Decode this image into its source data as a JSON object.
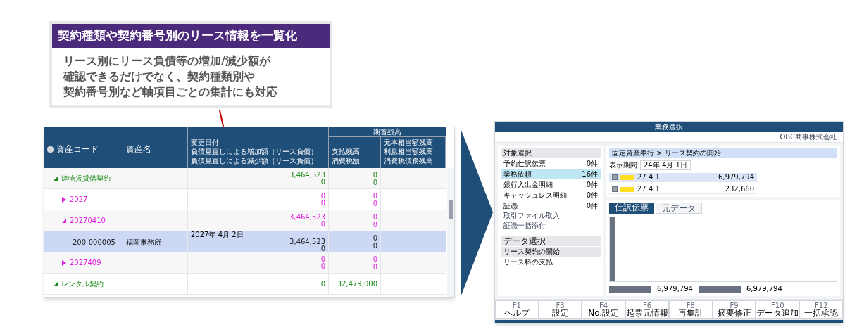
{
  "callout": {
    "title": "契約種類や契約番号別のリース情報を一覧化",
    "body": [
      "リース別にリース負債等の増加/減少額が",
      "確認できるだけでなく、契約種類別や",
      "契約番号別など軸項目ごとの集計にも対応"
    ]
  },
  "left_table": {
    "group_header": "期首残高",
    "columns": [
      [
        "資産コード"
      ],
      [
        "資産名"
      ],
      [
        "変更日付",
        "負債見直しによる増加額（リース負債）",
        "負債見直しによる減少額（リース負債）"
      ],
      [
        "支払残高",
        "消費税額"
      ],
      [
        "元本相当額残高",
        "利息相当額残高",
        "消費税債務残高"
      ]
    ],
    "rows": [
      {
        "kind": "group",
        "code": "建物賃貸借契約",
        "expanded": true,
        "selected": false,
        "color": "#1a8a1a",
        "amounts": [
          "3,464,523",
          "0"
        ],
        "balances": [
          "0",
          "0"
        ]
      },
      {
        "kind": "group",
        "code": "2027",
        "expanded": false,
        "selected": false,
        "color": "#e020e0",
        "amounts": [
          "0",
          "0"
        ],
        "balances": [
          "0",
          "0"
        ]
      },
      {
        "kind": "group",
        "code": "20270410",
        "expanded": true,
        "selected": false,
        "color": "#e020e0",
        "amounts": [
          "3,464,523",
          "0"
        ],
        "balances": [
          "0",
          "0"
        ]
      },
      {
        "kind": "item",
        "code": "200-000005",
        "name": "福岡事務所",
        "date": "2027年  4月  2日",
        "selected": true,
        "amounts": [
          "3,464,523",
          "0"
        ],
        "balances": [
          "0",
          "0"
        ]
      },
      {
        "kind": "group",
        "code": "2027409",
        "expanded": false,
        "selected": false,
        "color": "#e020e0",
        "amounts": [
          "0",
          "0"
        ],
        "balances": [
          "0",
          "0"
        ]
      },
      {
        "kind": "group",
        "code": "レンタル契約",
        "expanded": true,
        "selected": false,
        "color": "#1a8a1a",
        "amounts": [
          "0"
        ],
        "balances": [
          "32,479,000"
        ]
      }
    ]
  },
  "app": {
    "title": "業務選択",
    "company": "OBC商事株式会社",
    "sidebar_heading": "対象選択",
    "targets": [
      {
        "label": "予約仕訳伝票",
        "count": "0",
        "unit": "件",
        "selected": false
      },
      {
        "label": "業務依頼",
        "count": "16",
        "unit": "件",
        "selected": true
      },
      {
        "label": "銀行入出金明細",
        "count": "0",
        "unit": "件",
        "selected": false
      },
      {
        "label": "キャッシュレス明細",
        "count": "0",
        "unit": "件",
        "selected": false
      },
      {
        "label": "証憑",
        "count": "0",
        "unit": "件",
        "selected": false
      }
    ],
    "links": [
      "取引ファイル取入",
      "証憑一括添付"
    ],
    "data_heading": "データ選択",
    "data_items": [
      {
        "label": "リース契約の開始",
        "selected": true
      },
      {
        "label": "リース料の支払",
        "selected": false
      }
    ],
    "breadcrumb": "固定資産奉行 > リース契約の開始",
    "period_label": "表示期間",
    "period_from": "24年 4月 1日",
    "list_rows": [
      {
        "checked": true,
        "date": "27  4  1",
        "amount": "6,979,794",
        "selected": true
      },
      {
        "checked": true,
        "date": "27  4  1",
        "amount": "232,660",
        "selected": false
      }
    ],
    "tabs": [
      {
        "label": "仕訳伝票",
        "selected": true
      },
      {
        "label": "元データ",
        "selected": false
      }
    ],
    "debit_total": "6,979,794",
    "credit_total": "6,979,794",
    "fkeys": [
      {
        "key": "F1",
        "label": "ヘルプ"
      },
      {
        "key": "F3",
        "label": "設定"
      },
      {
        "key": "F4",
        "label": "No.設定"
      },
      {
        "key": "F6",
        "label": "起票元情報"
      },
      {
        "key": "F8",
        "label": "再集計"
      },
      {
        "key": "F9",
        "label": "摘要修正"
      },
      {
        "key": "F10",
        "label": "データ追加"
      },
      {
        "key": "F12",
        "label": "一括承認"
      }
    ]
  }
}
